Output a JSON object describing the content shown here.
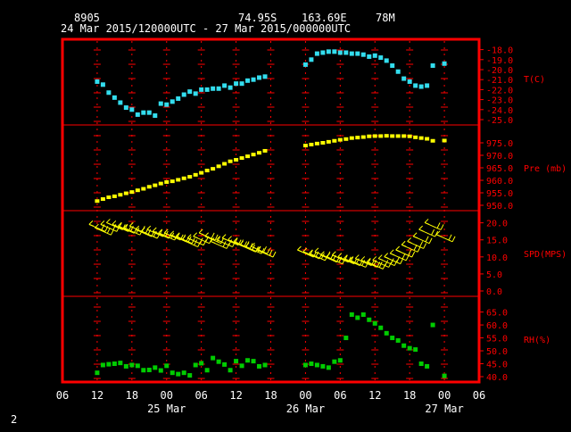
{
  "header": {
    "station_id": "8905",
    "lat": "74.95S",
    "lon": "163.69E",
    "elev": "78M",
    "time_range": "24 Mar 2015/120000UTC - 27 Mar 2015/000000UTC"
  },
  "footer": {
    "page_number": "2"
  },
  "colors": {
    "background": "#000000",
    "frame": "#ff0000",
    "header_text": "#ffffff",
    "axis_text": "#ff0000",
    "temperature": "#33ddee",
    "pressure": "#ffff00",
    "wind": "#ffff00",
    "humidity": "#00cc00"
  },
  "chart_data": {
    "type": "meteogram",
    "x_axis": {
      "unit": "hours since 24 Mar 00 UTC",
      "range": [
        6,
        78
      ],
      "tick_labels": [
        "06",
        "12",
        "18",
        "00",
        "06",
        "12",
        "18",
        "00",
        "06",
        "12",
        "18",
        "00",
        "06"
      ],
      "tick_hours": [
        6,
        12,
        18,
        24,
        30,
        36,
        42,
        48,
        54,
        60,
        66,
        72,
        78
      ],
      "date_labels": [
        {
          "label": "25 Mar",
          "hour": 24
        },
        {
          "label": "26 Mar",
          "hour": 48
        },
        {
          "label": "27 Mar",
          "hour": 72
        }
      ]
    },
    "panels": [
      {
        "name": "temperature",
        "label": "T(C)",
        "range": [
          -25,
          -17.5
        ],
        "tick_values": [
          -18,
          -19,
          -20,
          -21,
          -22,
          -23,
          -24,
          -25
        ],
        "tick_labels": [
          "-18.0",
          "-19.0",
          "-20.0",
          "-21.0",
          "-22.0",
          "-23.0",
          "-24.0",
          "-25.0"
        ],
        "x": [
          12,
          13,
          14,
          15,
          16,
          17,
          18,
          19,
          20,
          21,
          22,
          23,
          24,
          25,
          26,
          27,
          28,
          29,
          30,
          31,
          32,
          33,
          34,
          35,
          36,
          37,
          38,
          39,
          40,
          41,
          48,
          49,
          50,
          51,
          52,
          53,
          54,
          55,
          56,
          57,
          58,
          59,
          60,
          61,
          62,
          63,
          64,
          65,
          66,
          67,
          68,
          69,
          70,
          72
        ],
        "y": [
          -21.2,
          -21.5,
          -22.3,
          -22.8,
          -23.3,
          -23.8,
          -24,
          -24.5,
          -24.3,
          -24.3,
          -24.6,
          -23.4,
          -23.5,
          -23.2,
          -22.9,
          -22.5,
          -22.2,
          -22.4,
          -22,
          -22,
          -21.9,
          -21.9,
          -21.6,
          -21.8,
          -21.4,
          -21.4,
          -21.1,
          -21,
          -20.8,
          -20.7,
          -19.5,
          -19,
          -18.4,
          -18.3,
          -18.2,
          -18.2,
          -18.3,
          -18.3,
          -18.4,
          -18.4,
          -18.5,
          -18.7,
          -18.6,
          -18.8,
          -19.1,
          -19.6,
          -20.2,
          -20.9,
          -21.2,
          -21.6,
          -21.7,
          -21.6,
          -19.6,
          -19.4
        ]
      },
      {
        "name": "pressure",
        "label": "Pre (mb)",
        "range": [
          950,
          980
        ],
        "tick_values": [
          950,
          955,
          960,
          965,
          970,
          975
        ],
        "tick_labels": [
          "950.0",
          "955.0",
          "960.0",
          "965.0",
          "970.0",
          "975.0"
        ],
        "x": [
          12,
          13,
          14,
          15,
          16,
          17,
          18,
          19,
          20,
          21,
          22,
          23,
          24,
          25,
          26,
          27,
          28,
          29,
          30,
          31,
          32,
          33,
          34,
          35,
          36,
          37,
          38,
          39,
          40,
          41,
          48,
          49,
          50,
          51,
          52,
          53,
          54,
          55,
          56,
          57,
          58,
          59,
          60,
          61,
          62,
          63,
          64,
          65,
          66,
          67,
          68,
          69,
          70,
          72
        ],
        "y": [
          951.7,
          952.5,
          953.2,
          953.6,
          954.2,
          954.8,
          955.3,
          956,
          956.6,
          957.4,
          958,
          958.7,
          959.3,
          959.6,
          960.2,
          960.8,
          961.4,
          962.2,
          963,
          963.9,
          964.6,
          965.6,
          966.6,
          967.6,
          968.2,
          968.9,
          969.6,
          970.3,
          971,
          971.8,
          973.9,
          974.3,
          974.7,
          975,
          975.4,
          975.8,
          976.2,
          976.5,
          976.9,
          977.1,
          977.3,
          977.6,
          977.7,
          977.7,
          977.8,
          977.7,
          977.7,
          977.7,
          977.6,
          977.2,
          976.9,
          976.6,
          975.8,
          975.9
        ]
      },
      {
        "name": "wind_speed",
        "label": "SPD(MPS)",
        "range": [
          0,
          22
        ],
        "tick_values": [
          0,
          5,
          10,
          15,
          20
        ],
        "tick_labels": [
          "0.0",
          "5.0",
          "10.0",
          "15.0",
          "20.0"
        ],
        "x": [
          12,
          13,
          14,
          15,
          16,
          17,
          18,
          19,
          20,
          21,
          22,
          23,
          24,
          25,
          26,
          27,
          28,
          29,
          30,
          31,
          32,
          33,
          34,
          35,
          36,
          37,
          38,
          39,
          40,
          41,
          48,
          49,
          50,
          51,
          52,
          53,
          54,
          55,
          56,
          57,
          58,
          59,
          60,
          61,
          62,
          63,
          64,
          65,
          66,
          67,
          68,
          69,
          70,
          72
        ],
        "y": [
          18.5,
          17.5,
          18.5,
          19,
          18.5,
          18,
          17.5,
          18,
          17,
          16.5,
          17,
          16.5,
          16,
          16,
          15.5,
          15,
          14,
          14.5,
          15,
          16,
          15,
          13.5,
          14,
          14.5,
          14,
          13.5,
          12.5,
          12,
          12,
          11,
          11,
          10.5,
          10,
          10.5,
          9.5,
          9,
          9.5,
          9,
          8.5,
          8,
          8.5,
          8,
          7.5,
          8,
          8.5,
          9,
          10,
          11,
          12.5,
          13.5,
          15,
          17,
          19,
          15.5
        ]
      },
      {
        "name": "relative_humidity",
        "label": "RH(%)",
        "range": [
          40,
          69
        ],
        "tick_values": [
          40,
          45,
          50,
          55,
          60,
          65
        ],
        "tick_labels": [
          "40.0",
          "45.0",
          "50.0",
          "55.0",
          "60.0",
          "65.0"
        ],
        "x": [
          12,
          13,
          14,
          15,
          16,
          17,
          18,
          19,
          20,
          21,
          22,
          23,
          24,
          25,
          26,
          27,
          28,
          29,
          30,
          31,
          32,
          33,
          34,
          35,
          36,
          37,
          38,
          39,
          40,
          41,
          48,
          49,
          50,
          51,
          52,
          53,
          54,
          55,
          56,
          57,
          58,
          59,
          60,
          61,
          62,
          63,
          64,
          65,
          66,
          67,
          68,
          69,
          70,
          72
        ],
        "y": [
          41.5,
          44.5,
          44.8,
          45,
          45.3,
          44,
          44.5,
          44.2,
          42.5,
          42.6,
          43.5,
          42.4,
          44.2,
          41.5,
          41,
          41.5,
          40.5,
          44.5,
          45.2,
          42.5,
          47.2,
          45.8,
          44.7,
          42.5,
          46,
          44.2,
          46.3,
          46,
          44,
          44.5,
          44.5,
          45,
          44.5,
          44,
          43.5,
          45.8,
          46.3,
          55,
          64,
          62.8,
          64,
          62,
          60.6,
          58.9,
          56.8,
          55,
          54,
          52,
          51,
          50.5,
          45,
          44,
          60,
          40.3
        ]
      }
    ]
  }
}
